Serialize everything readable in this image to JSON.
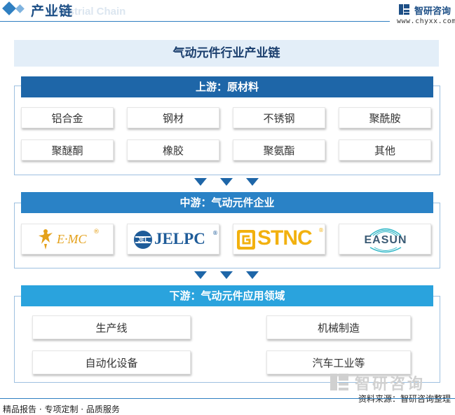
{
  "header": {
    "title": "产业链",
    "subtitle_watermark": "Industrial Chain",
    "logo_name": "智研咨询",
    "logo_url": "www.chyxx.com"
  },
  "diagram": {
    "title": "气动元件行业产业链",
    "upstream": {
      "label": "上游：原材料",
      "items": [
        "铝合金",
        "钢材",
        "不锈钢",
        "聚酰胺",
        "聚醚酮",
        "橡胶",
        "聚氨酯",
        "其他"
      ]
    },
    "midstream": {
      "label": "中游：气动元件企业",
      "companies": [
        {
          "text": "E·MC",
          "mark": "®",
          "color": "#e4a11b",
          "icon": "emc-figure-logo-icon"
        },
        {
          "text": "JELPC",
          "mark": "®",
          "color": "#1f5c99",
          "icon": "jelpc-logo-icon"
        },
        {
          "text": "STNC",
          "mark": "®",
          "color": "#f2b10f",
          "icon": "stnc-logo-icon"
        },
        {
          "text": "EASUN",
          "mark": "",
          "color": "#3a5a74",
          "icon": "easun-logo-icon"
        }
      ]
    },
    "downstream": {
      "label": "下游：气动元件应用领域",
      "items": [
        "生产线",
        "机械制造",
        "自动化设备",
        "汽车工业等"
      ]
    }
  },
  "footer": {
    "left": "精品报告 · 专项定制 · 品质服务",
    "source": "资料来源：智研咨询整理",
    "watermark": "智研咨询"
  },
  "colors": {
    "upstream_bar": "#1e66a8",
    "midstream_bar": "#2a82c6",
    "downstream_bar": "#2aa3dd",
    "arrow": "#1e66a8"
  }
}
